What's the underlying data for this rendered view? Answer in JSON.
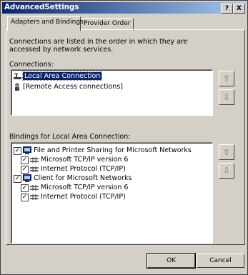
{
  "window": {
    "title": "AdvancedSettings",
    "help_glyph": "?",
    "close_glyph": "X"
  },
  "tabs": [
    {
      "label": "Adapters and Bindings",
      "active": true
    },
    {
      "label": "Provider Order",
      "active": false
    }
  ],
  "description": "Connections are listed in the order in which they are accessed by network services.",
  "connections": {
    "label": "Connections:",
    "items": [
      {
        "label": "Local Area Connection",
        "selected": true,
        "icon": "network-adapter-icon"
      },
      {
        "label": "[Remote Access connections]",
        "selected": false,
        "icon": "remote-access-icon"
      }
    ],
    "up_glyph": "⇧",
    "down_glyph": "⇩"
  },
  "bindings": {
    "label": "Bindings for Local Area Connection:",
    "items": [
      {
        "label": "File and Printer Sharing for Microsoft Networks",
        "checked": true,
        "level": 0,
        "icon": "service-icon"
      },
      {
        "label": "Microsoft TCP/IP version 6",
        "checked": true,
        "level": 1,
        "icon": "protocol-icon"
      },
      {
        "label": "Internet Protocol (TCP/IP)",
        "checked": true,
        "level": 1,
        "icon": "protocol-icon"
      },
      {
        "label": "Client for Microsoft Networks",
        "checked": true,
        "level": 0,
        "icon": "client-icon"
      },
      {
        "label": "Microsoft TCP/IP version 6",
        "checked": true,
        "level": 1,
        "icon": "protocol-icon"
      },
      {
        "label": "Internet Protocol (TCP/IP)",
        "checked": true,
        "level": 1,
        "icon": "protocol-icon"
      }
    ],
    "up_glyph": "⇧",
    "down_glyph": "⇩"
  },
  "buttons": {
    "ok": "OK",
    "cancel": "Cancel"
  },
  "check_glyph": "✓"
}
